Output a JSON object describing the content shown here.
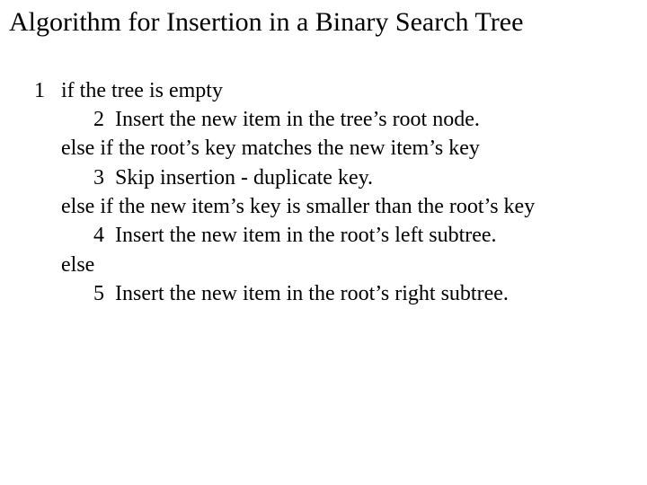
{
  "title": "Algorithm for Insertion in a Binary Search Tree",
  "lines": {
    "l1": "1   if the tree is empty",
    "l2": "           2  Insert the new item in the tree’s root node.",
    "l3": "     else if the root’s key matches the new item’s key",
    "l4": "           3  Skip insertion - duplicate key.",
    "l5": "     else if the new item’s key is smaller than the root’s key",
    "l6": "           4  Insert the new item in the root’s left subtree.",
    "l7": "     else",
    "l8": "           5  Insert the new item in the root’s right subtree."
  }
}
